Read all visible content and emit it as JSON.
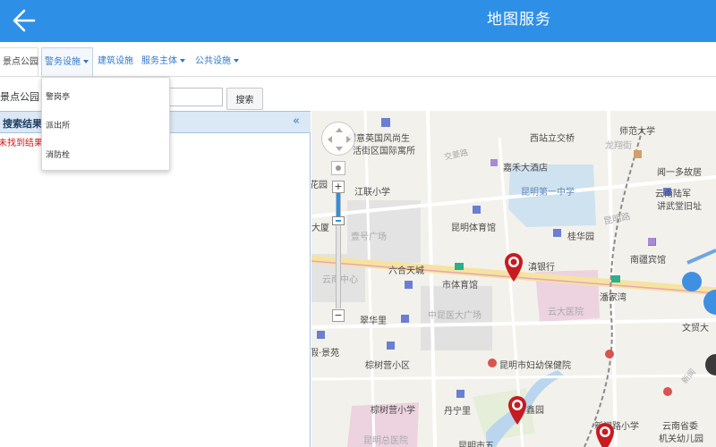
{
  "header": {
    "title": "地图服务"
  },
  "tabs": {
    "scenic": "景点公园",
    "police": "警务设施",
    "building": "建筑设施",
    "subject": "服务主体",
    "public": "公共设施"
  },
  "dropdown": {
    "items": [
      "警岗亭",
      "派出所",
      "消防栓"
    ]
  },
  "search": {
    "label": "景点公园",
    "value": "",
    "button": "搜索"
  },
  "results": {
    "title": "搜索结果",
    "empty": "未找到结果",
    "collapse_glyph": "«"
  },
  "map": {
    "zoom_level_fraction": 0.24,
    "labels": [
      "创意英国风尚生",
      "活街区国际寓所",
      "西站立交桥",
      "师范大学",
      "龙翔街",
      "交菱路",
      "嘉禾大酒店",
      "闻一多故居",
      "花园",
      "江联小学",
      "昆明第一中学",
      "云南陆军",
      "讲武堂旧址",
      "昆明体育馆",
      "昆明路",
      "大厦",
      "壹号广场",
      "桂华园",
      "南疆宾馆",
      "六合天城",
      "滇银行",
      "云南中心",
      "市体育馆",
      "潘家湾",
      "云大医院",
      "文贸大",
      "翠华里",
      "中昆医大广场",
      "假·景苑",
      "棕树营小区",
      "昆明市妇幼保健院",
      "新闻",
      "棕树营小学",
      "丹宁里",
      "鑫园",
      "新闻路小学",
      "云南省委",
      "机关幼儿园",
      "昆明总医院",
      "昆明市五"
    ]
  }
}
